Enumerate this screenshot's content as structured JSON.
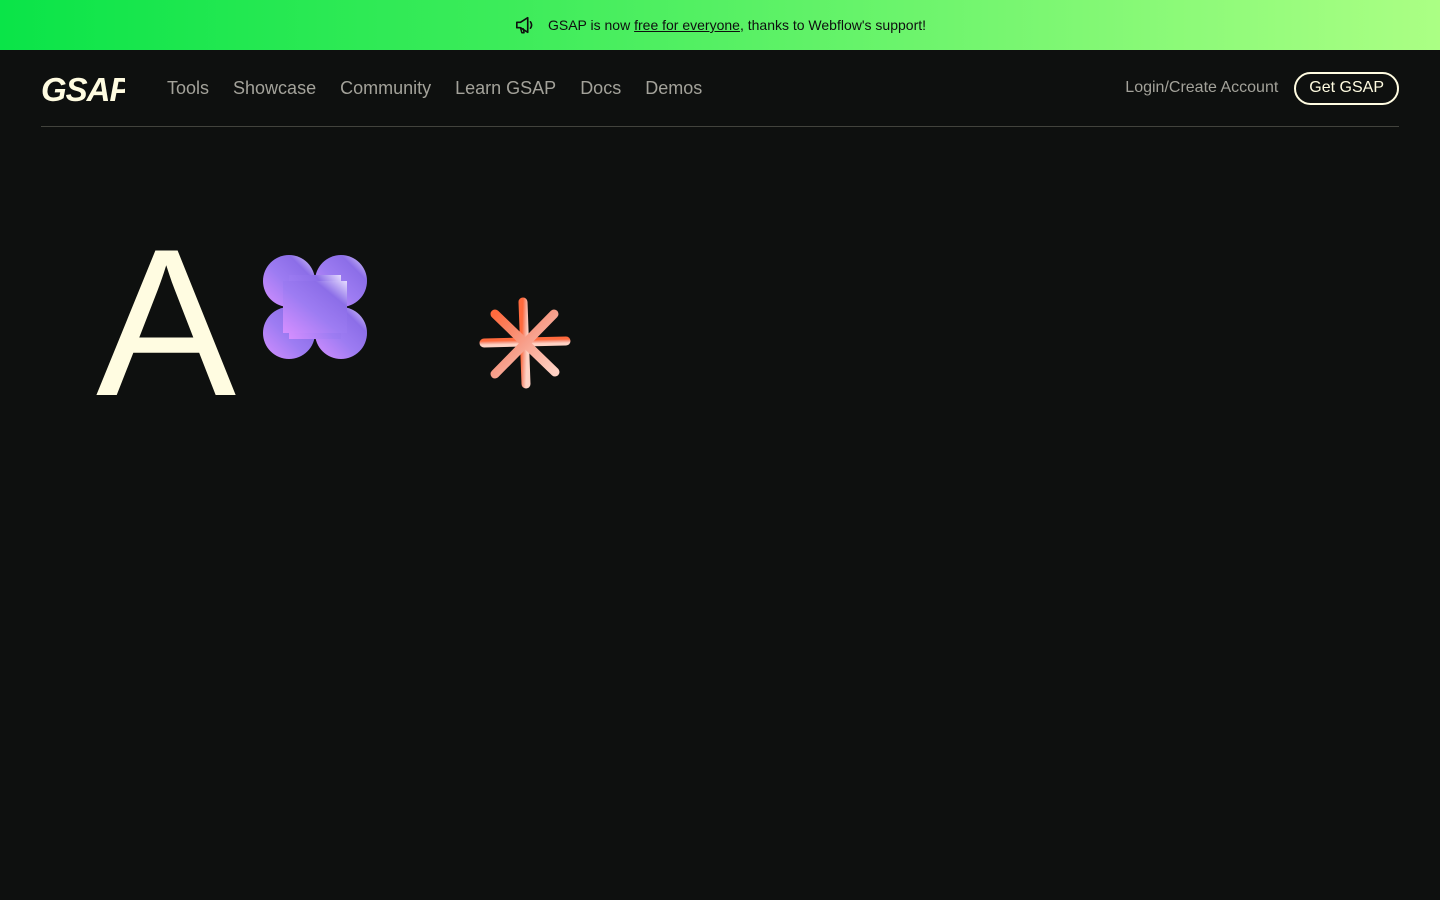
{
  "announcement": {
    "icon": "megaphone-icon",
    "prefix": "GSAP is now ",
    "link_text": "free for everyone",
    "suffix": ", thanks to Webflow's support!",
    "gradient": [
      "#0ae448",
      "#abff84"
    ]
  },
  "nav": {
    "logo_text": "GSAP",
    "links": [
      "Tools",
      "Showcase",
      "Community",
      "Learn GSAP",
      "Docs",
      "Demos"
    ],
    "login_label": "Login/Create Account",
    "cta_label": "Get GSAP"
  },
  "hero": {
    "letter": "A",
    "shapes": [
      "flower-shape",
      "asterisk-shape"
    ]
  },
  "colors": {
    "background": "#0e100f",
    "cream": "#fffce1",
    "muted": "#a3a29a",
    "purple": "#9d7cf2",
    "pink": "#f4a58d",
    "orange": "#ff8709"
  }
}
